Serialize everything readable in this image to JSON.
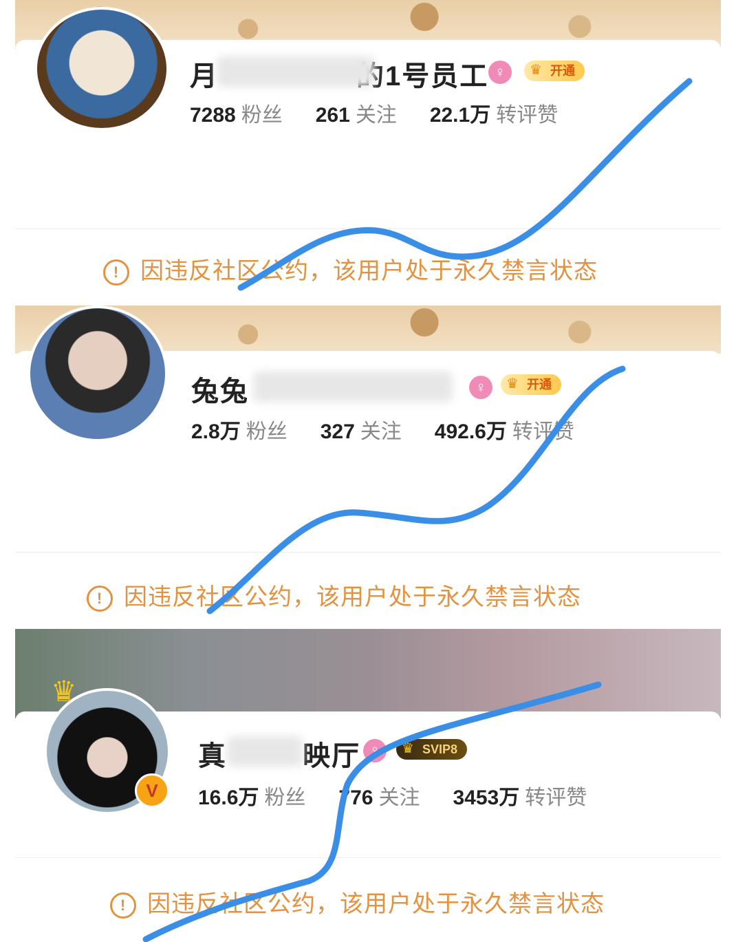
{
  "colors": {
    "warning": "#e39240",
    "curve": "#3a8ee6",
    "vip_text": "#d9590b"
  },
  "cards": [
    {
      "name": "月",
      "name_tail": "的1号员工",
      "gender_icon": "female-icon",
      "vip_label": "开通",
      "fans_num": "7288",
      "fans_label": "粉丝",
      "follow_num": "261",
      "follow_label": "关注",
      "likes_num": "22.1万",
      "likes_label": "转评赞",
      "warning": "因违反社区公约，该用户处于永久禁言状态"
    },
    {
      "name": "兔兔",
      "name_tail": "",
      "gender_icon": "female-icon",
      "vip_label": "开通",
      "fans_num": "2.8万",
      "fans_label": "粉丝",
      "follow_num": "327",
      "follow_label": "关注",
      "likes_num": "492.6万",
      "likes_label": "转评赞",
      "warning": "因违反社区公约，该用户处于永久禁言状态"
    },
    {
      "name": "真",
      "name_tail": "映厅",
      "gender_icon": "female-icon",
      "vip_label": "SVIP8",
      "fans_num": "16.6万",
      "fans_label": "粉丝",
      "follow_num": "776",
      "follow_label": "关注",
      "likes_num": "3453万",
      "likes_label": "转评赞",
      "warning": "因违反社区公约，该用户处于永久禁言状态"
    }
  ]
}
